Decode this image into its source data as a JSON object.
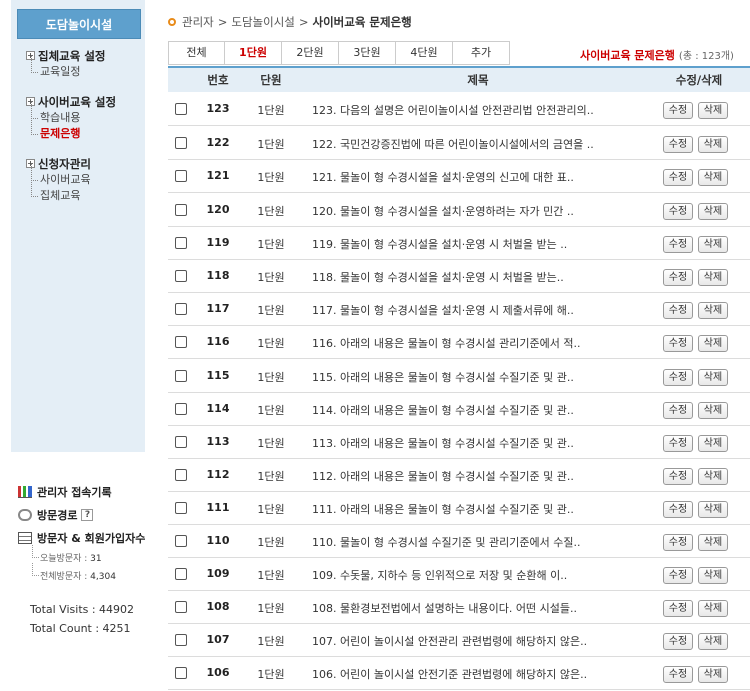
{
  "sidebar": {
    "title": "도담놀이시설",
    "groups": [
      {
        "label": "집체교육 설정",
        "items": [
          "교육일정"
        ]
      },
      {
        "label": "사이버교육 설정",
        "items": [
          "학습내용",
          "문제은행"
        ]
      },
      {
        "label": "신청자관리",
        "items": [
          "사이버교육",
          "집체교육"
        ]
      }
    ],
    "stats": {
      "admin_log": "관리자 접속기록",
      "visit_path": "방문경로",
      "visitor_signup": "방문자 & 회원가입자수",
      "today_label": "오늘방문자 :",
      "today_value": "31",
      "total_label": "전체방문자 :",
      "total_value": "4,304",
      "total_visits": "Total Visits : 44902",
      "total_count": "Total Count : 4251",
      "help": "?"
    }
  },
  "breadcrumb": [
    "관리자",
    "도담놀이시설",
    "사이버교육 문제은행"
  ],
  "tabs": [
    "전체",
    "1단원",
    "2단원",
    "3단원",
    "4단원",
    "추가"
  ],
  "active_tab": "1단원",
  "bank": {
    "title": "사이버교육 문제은행",
    "count": "(총 : 123개)"
  },
  "table": {
    "headers": {
      "no": "번호",
      "unit": "단원",
      "title": "제목",
      "edit": "수정/삭제"
    },
    "edit_label": "수정",
    "delete_label": "삭제",
    "rows": [
      {
        "no": "123",
        "unit": "1단원",
        "title": "123. 다음의 설명은 어린이놀이시설 안전관리법 안전관리의.."
      },
      {
        "no": "122",
        "unit": "1단원",
        "title": "122. 국민건강증진법에 따른 어린이놀이시설에서의 금연을 .."
      },
      {
        "no": "121",
        "unit": "1단원",
        "title": "121. 물놀이 형 수경시설을 설치·운영의 신고에 대한 표.."
      },
      {
        "no": "120",
        "unit": "1단원",
        "title": "120. 물놀이 형 수경시설을 설치·운영하려는 자가 민간 .."
      },
      {
        "no": "119",
        "unit": "1단원",
        "title": "119. 물놀이 형 수경시설을 설치·운영 시 처벌을 받는 .."
      },
      {
        "no": "118",
        "unit": "1단원",
        "title": "118. 물놀이 형 수경시설을 설치·운영 시 처벌을 받는.."
      },
      {
        "no": "117",
        "unit": "1단원",
        "title": "117. 물놀이 형 수경시설을 설치·운영 시 제출서류에 해.."
      },
      {
        "no": "116",
        "unit": "1단원",
        "title": "116. 아래의 내용은 물놀이 형 수경시설 관리기준에서 적.."
      },
      {
        "no": "115",
        "unit": "1단원",
        "title": "115. 아래의 내용은 물놀이 형 수경시설 수질기준 및 관.."
      },
      {
        "no": "114",
        "unit": "1단원",
        "title": "114. 아래의 내용은 물놀이 형 수경시설 수질기준 및 관.."
      },
      {
        "no": "113",
        "unit": "1단원",
        "title": "113. 아래의 내용은 물놀이 형 수경시설 수질기준 및 관.."
      },
      {
        "no": "112",
        "unit": "1단원",
        "title": "112. 아래의 내용은 물놀이 형 수경시설 수질기준 및 관.."
      },
      {
        "no": "111",
        "unit": "1단원",
        "title": "111. 아래의 내용은 물놀이 형 수경시설 수질기준 및 관.."
      },
      {
        "no": "110",
        "unit": "1단원",
        "title": "110. 물놀이 형 수경시설 수질기준 및 관리기준에서 수질.."
      },
      {
        "no": "109",
        "unit": "1단원",
        "title": "109. 수돗물, 지하수 등 인위적으로 저장 및 순환해 이.."
      },
      {
        "no": "108",
        "unit": "1단원",
        "title": "108. 물환경보전법에서 설명하는 내용이다. 어떤 시설들.."
      },
      {
        "no": "107",
        "unit": "1단원",
        "title": "107. 어린이 놀이시설 안전관리 관련법령에 해당하지 않은.."
      },
      {
        "no": "106",
        "unit": "1단원",
        "title": "106. 어린이 놀이시설 안전기준 관련법령에 해당하지 않은.."
      }
    ]
  }
}
